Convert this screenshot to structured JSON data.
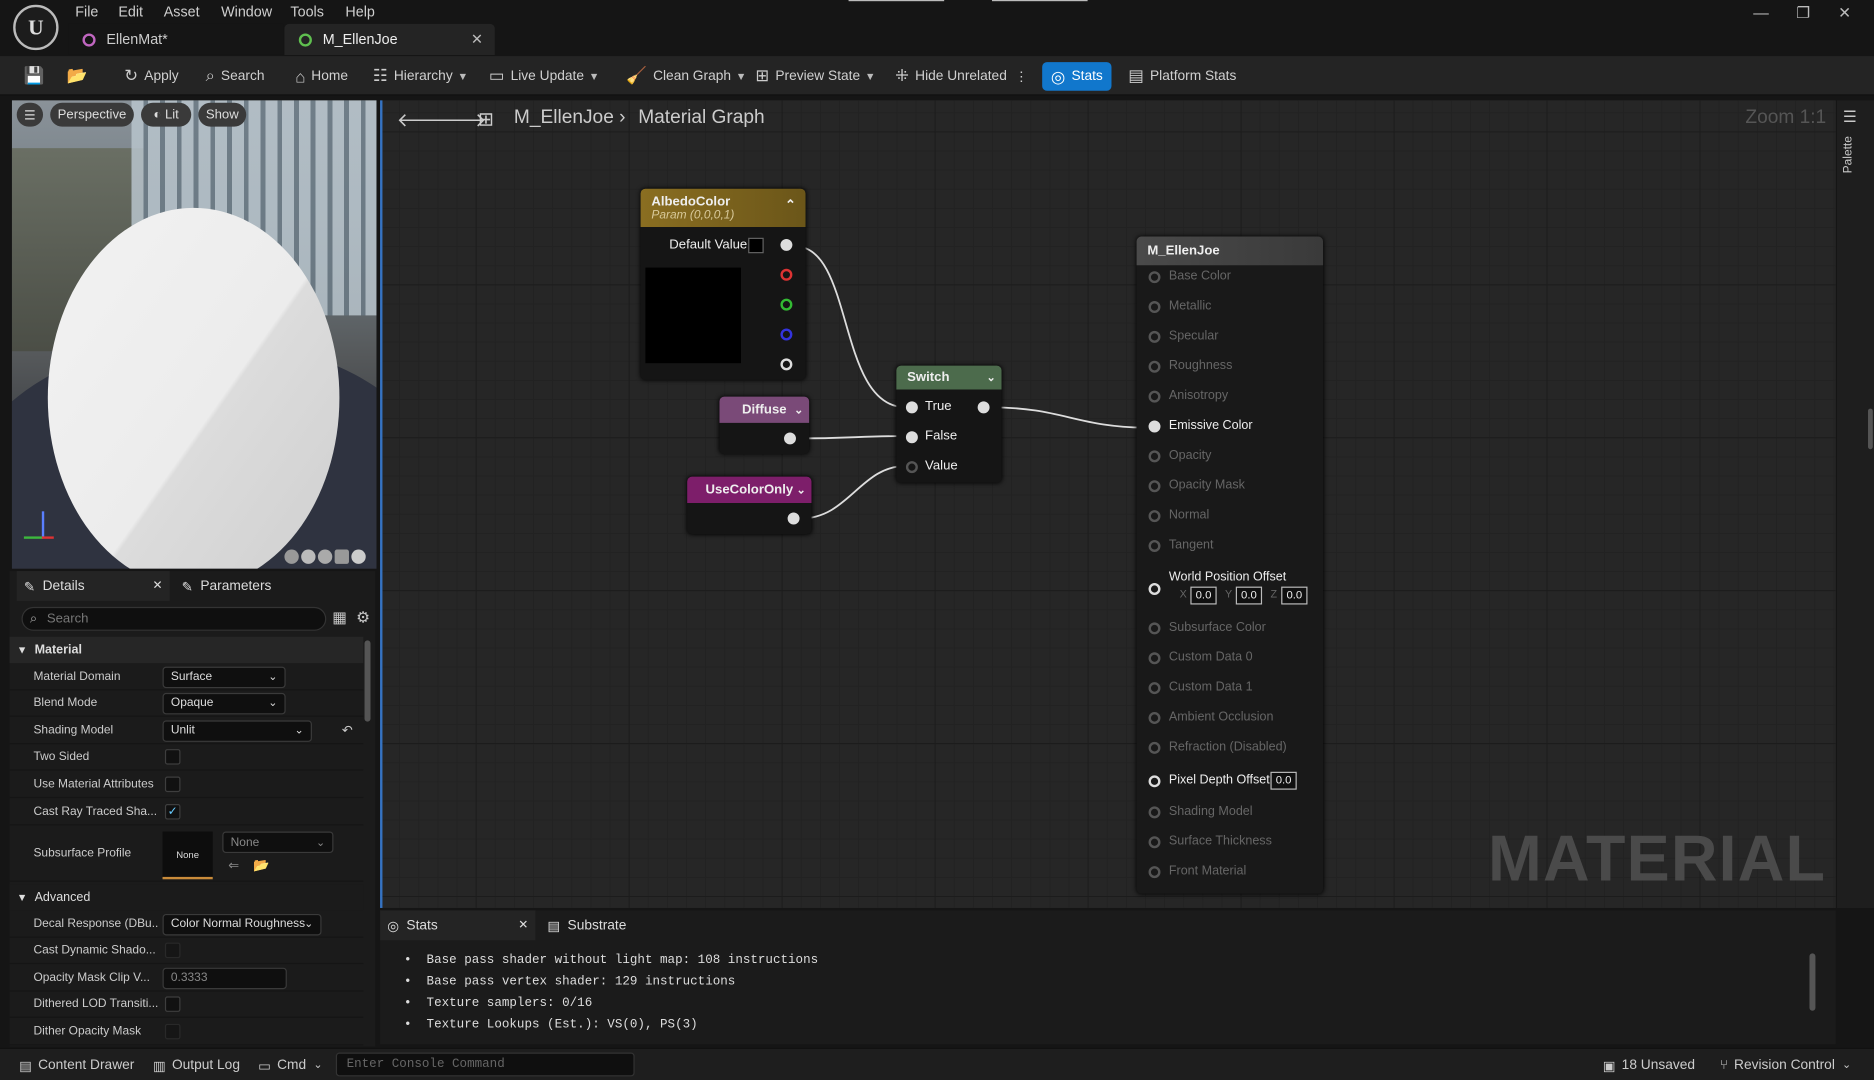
{
  "menu": [
    "File",
    "Edit",
    "Asset",
    "Window",
    "Tools",
    "Help"
  ],
  "tabs": [
    {
      "label": "EllenMat*"
    },
    {
      "label": "M_EllenJoe"
    }
  ],
  "toolbar": {
    "apply": "Apply",
    "search": "Search",
    "home": "Home",
    "hierarchy": "Hierarchy",
    "live_update": "Live Update",
    "clean_graph": "Clean Graph",
    "preview_state": "Preview State",
    "hide_unrelated": "Hide Unrelated",
    "stats": "Stats",
    "platform_stats": "Platform Stats"
  },
  "viewport": {
    "perspective": "Perspective",
    "lit": "Lit",
    "show": "Show"
  },
  "details": {
    "tab_details": "Details",
    "tab_parameters": "Parameters",
    "search_placeholder": "Search",
    "section_material": "Material",
    "material_domain_label": "Material Domain",
    "material_domain_value": "Surface",
    "blend_mode_label": "Blend Mode",
    "blend_mode_value": "Opaque",
    "shading_model_label": "Shading Model",
    "shading_model_value": "Unlit",
    "two_sided_label": "Two Sided",
    "use_material_attributes_label": "Use Material Attributes",
    "cast_ray_traced_label": "Cast Ray Traced Sha...",
    "subsurface_profile_label": "Subsurface Profile",
    "subsurface_thumb": "None",
    "subsurface_value": "None",
    "section_advanced": "Advanced",
    "decal_response_label": "Decal Response (DBu...",
    "decal_response_value": "Color Normal Roughness",
    "cast_dynamic_shadow_label": "Cast Dynamic Shado...",
    "opacity_mask_clip_label": "Opacity Mask Clip V...",
    "opacity_mask_clip_value": "0.3333",
    "dithered_lod_label": "Dithered LOD Transiti...",
    "dither_opacity_mask_label": "Dither Opacity Mask"
  },
  "graph": {
    "breadcrumb_asset": "M_EllenJoe",
    "breadcrumb_graph": "Material Graph",
    "zoom": "Zoom 1:1",
    "watermark": "MATERIAL",
    "palette_label": "Palette",
    "albedo_title": "AlbedoColor",
    "albedo_sub": "Param (0,0,0,1)",
    "albedo_default": "Default Value",
    "diffuse_title": "Diffuse",
    "usecoloronly_title": "UseColorOnly",
    "switch_title": "Switch",
    "switch_true": "True",
    "switch_false": "False",
    "switch_value": "Value",
    "material_node_title": "M_EllenJoe",
    "material_inputs": [
      "Base Color",
      "Metallic",
      "Specular",
      "Roughness",
      "Anisotropy",
      "Emissive Color",
      "Opacity",
      "Opacity Mask",
      "Normal",
      "Tangent"
    ],
    "wpo_label": "World Position Offset",
    "wpo_x": "0.0",
    "wpo_y": "0.0",
    "wpo_z": "0.0",
    "material_inputs2": [
      "Subsurface Color",
      "Custom Data 0",
      "Custom Data 1",
      "Ambient Occlusion",
      "Refraction (Disabled)"
    ],
    "pixel_depth_label": "Pixel Depth Offset",
    "pixel_depth_value": "0.0",
    "material_inputs3": [
      "Shading Model",
      "Surface Thickness",
      "Front Material"
    ]
  },
  "stats_panel": {
    "tab_stats": "Stats",
    "tab_substrate": "Substrate",
    "lines": [
      "Base pass shader without light map: 108 instructions",
      "Base pass vertex shader: 129 instructions",
      "Texture samplers: 0/16",
      "Texture Lookups (Est.): VS(0), PS(3)"
    ]
  },
  "bottom": {
    "content_drawer": "Content Drawer",
    "output_log": "Output Log",
    "cmd": "Cmd",
    "console_placeholder": "Enter Console Command",
    "unsaved": "18 Unsaved",
    "revision_control": "Revision Control"
  }
}
